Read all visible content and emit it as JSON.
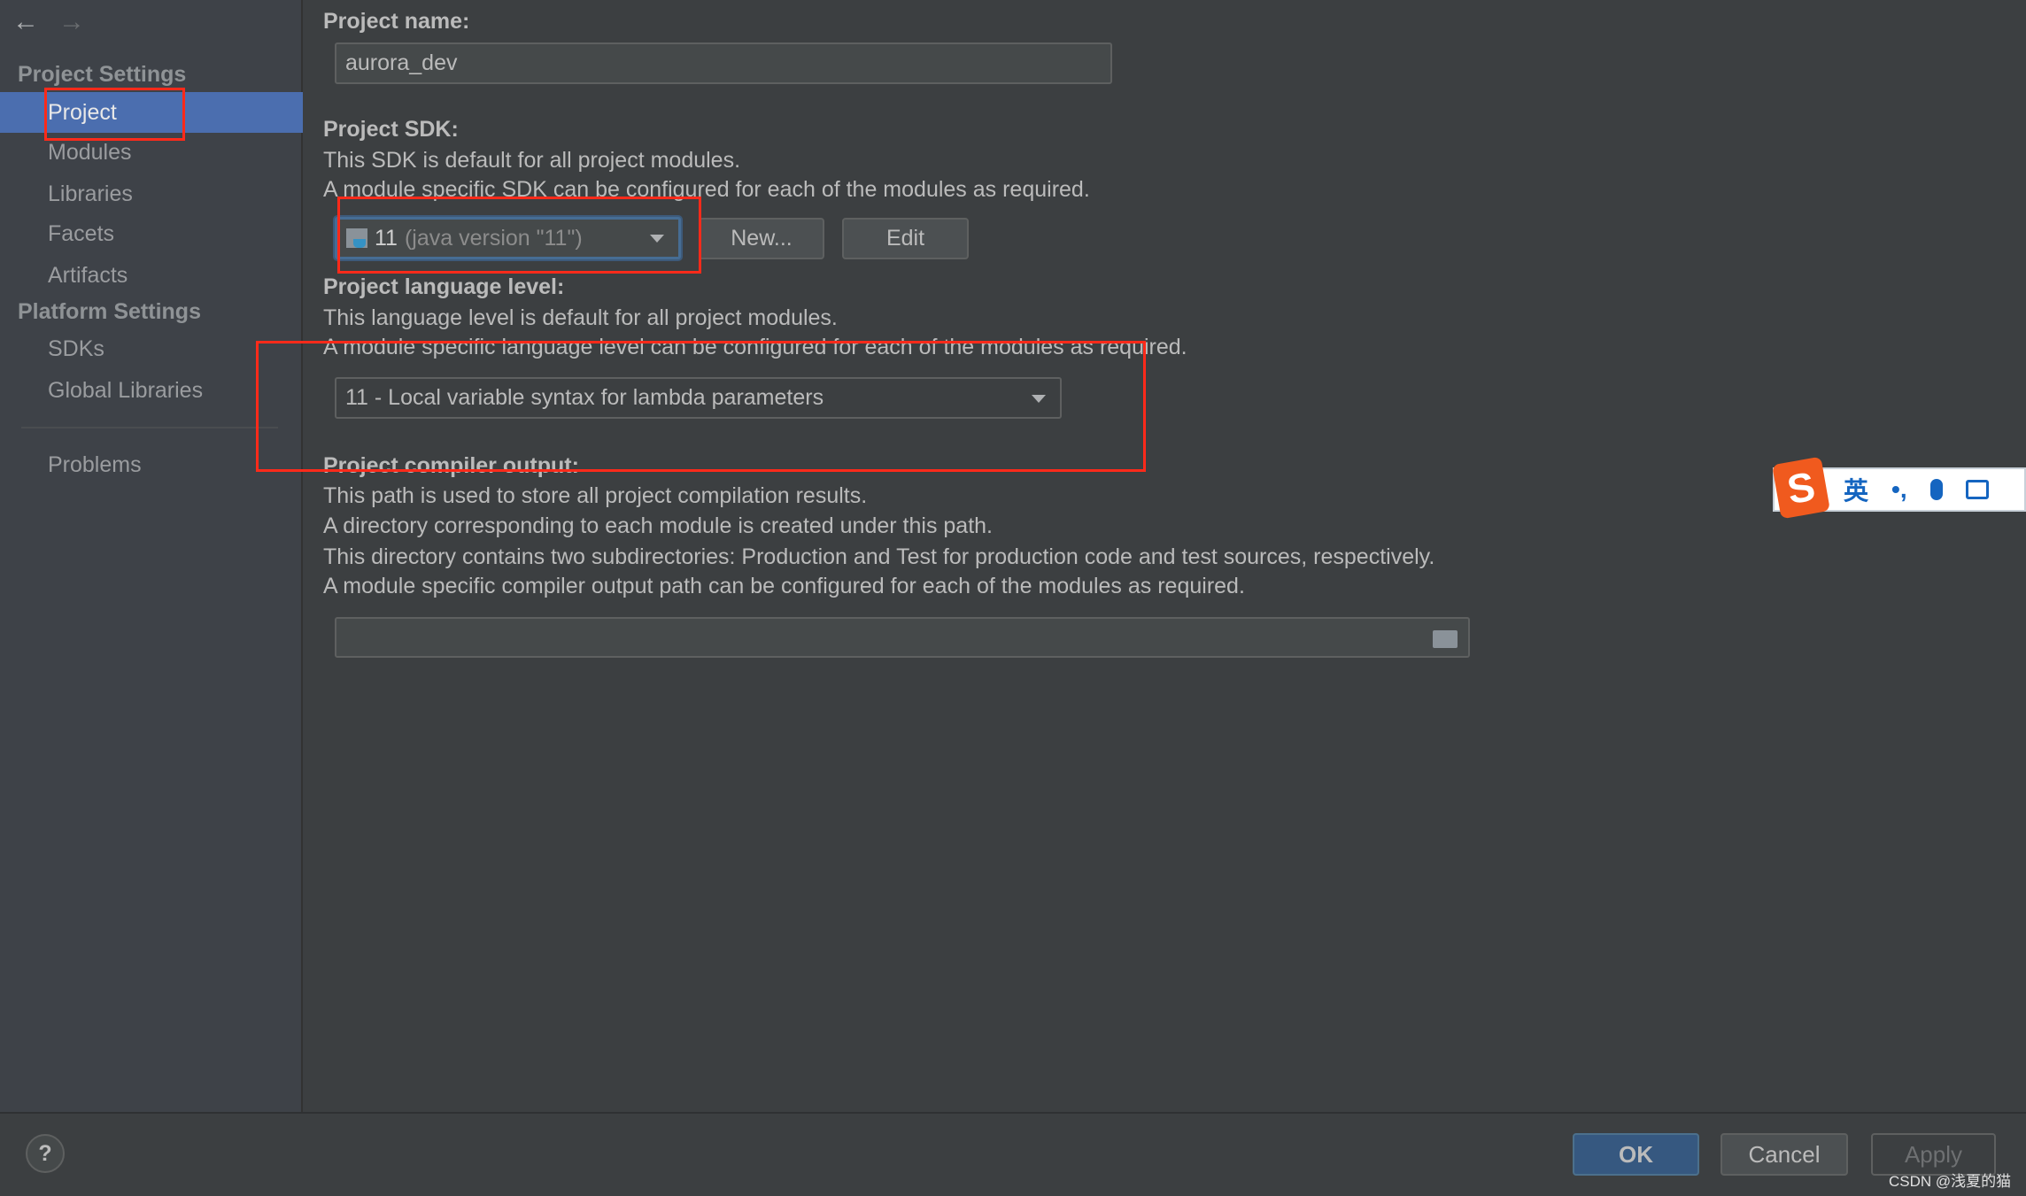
{
  "nav": {
    "back_icon": "arrow-left",
    "forward_icon": "arrow-right"
  },
  "sidebar": {
    "project_settings": "Project Settings",
    "items1": [
      {
        "label": "Project",
        "selected": true
      },
      {
        "label": "Modules"
      },
      {
        "label": "Libraries"
      },
      {
        "label": "Facets"
      },
      {
        "label": "Artifacts"
      }
    ],
    "platform_settings": "Platform Settings",
    "items2": [
      {
        "label": "SDKs"
      },
      {
        "label": "Global Libraries"
      }
    ],
    "problems": "Problems"
  },
  "main": {
    "project_name_label": "Project name:",
    "project_name_value": "aurora_dev",
    "sdk_label": "Project SDK:",
    "sdk_desc1": "This SDK is default for all project modules.",
    "sdk_desc2": "A module specific SDK can be configured for each of the modules as required.",
    "sdk_version": "11",
    "sdk_detail": "(java version \"11\")",
    "new_button": "New...",
    "edit_button": "Edit",
    "lang_label": "Project language level:",
    "lang_desc1": "This language level is default for all project modules.",
    "lang_desc2": "A module specific language level can be configured for each of the modules as required.",
    "lang_value": "11 - Local variable syntax for lambda parameters",
    "compiler_label": "Project compiler output:",
    "compiler_desc1": "This path is used to store all project compilation results.",
    "compiler_desc2": "A directory corresponding to each module is created under this path.",
    "compiler_desc3": "This directory contains two subdirectories: Production and Test for production code and test sources, respectively.",
    "compiler_desc4": "A module specific compiler output path can be configured for each of the modules as required.",
    "compiler_path": ""
  },
  "footer": {
    "help": "?",
    "ok": "OK",
    "cancel": "Cancel",
    "apply": "Apply"
  },
  "ime": {
    "logo": "S",
    "lang": "英",
    "punct": "•,"
  },
  "watermark": "CSDN @浅夏的猫",
  "colors": {
    "selection": "#4b6eaf",
    "annotation": "#ff2a1a",
    "ok": "#365880"
  }
}
